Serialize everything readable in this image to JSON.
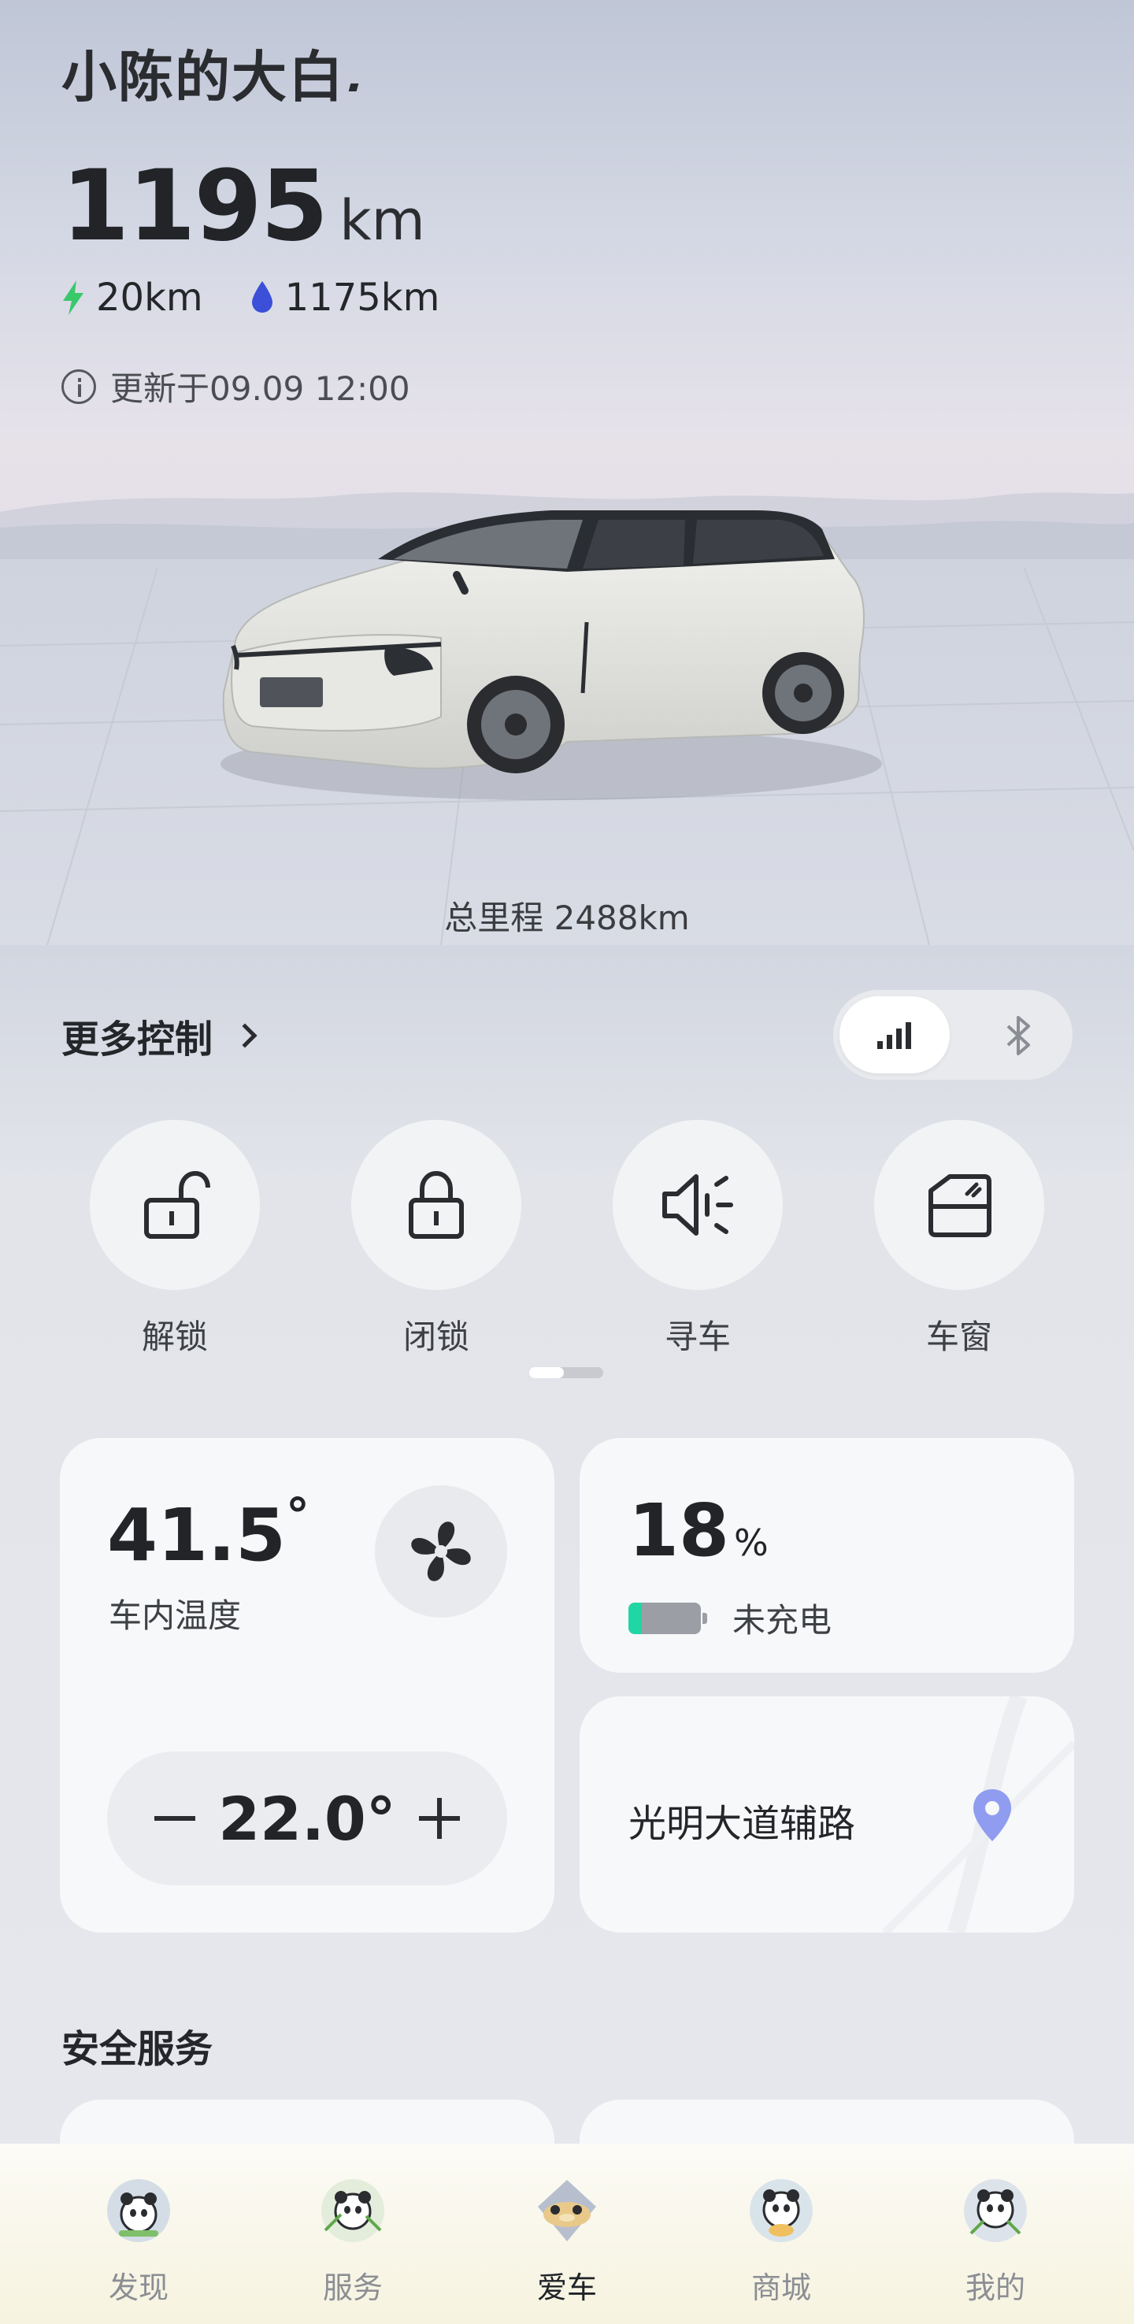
{
  "vehicle": {
    "name": "小陈的大白",
    "range_value": "1195",
    "range_unit": "km",
    "electric_range": "20km",
    "fuel_range": "1175km",
    "updated_text": "更新于09.09 12:00",
    "total_mileage": "总里程 2488km"
  },
  "controls": {
    "more_label": "更多控制",
    "connection": {
      "active": "signal",
      "inactive": "bluetooth"
    },
    "quick": [
      {
        "label": "解锁",
        "icon": "unlock-icon"
      },
      {
        "label": "闭锁",
        "icon": "lock-icon"
      },
      {
        "label": "寻车",
        "icon": "find-car-speaker-icon"
      },
      {
        "label": "车窗",
        "icon": "window-icon"
      }
    ],
    "page_index": 1,
    "page_count": 2
  },
  "climate": {
    "inside_temp": "41.5",
    "inside_temp_unit": "°",
    "label": "车内温度",
    "set_temp": "22.0°"
  },
  "battery": {
    "percent": "18",
    "percent_unit": "%",
    "level": 0.18,
    "status": "未充电"
  },
  "location": {
    "address": "光明大道辅路"
  },
  "safety": {
    "title": "安全服务"
  },
  "tabs": [
    {
      "label": "发现",
      "active": false
    },
    {
      "label": "服务",
      "active": false
    },
    {
      "label": "爱车",
      "active": true
    },
    {
      "label": "商城",
      "active": false
    },
    {
      "label": "我的",
      "active": false
    }
  ],
  "colors": {
    "accent_green": "#20d6a5",
    "electric_bolt": "#39c86a",
    "fuel_drop": "#3b4fd8",
    "pin": "#8f9cf0"
  }
}
